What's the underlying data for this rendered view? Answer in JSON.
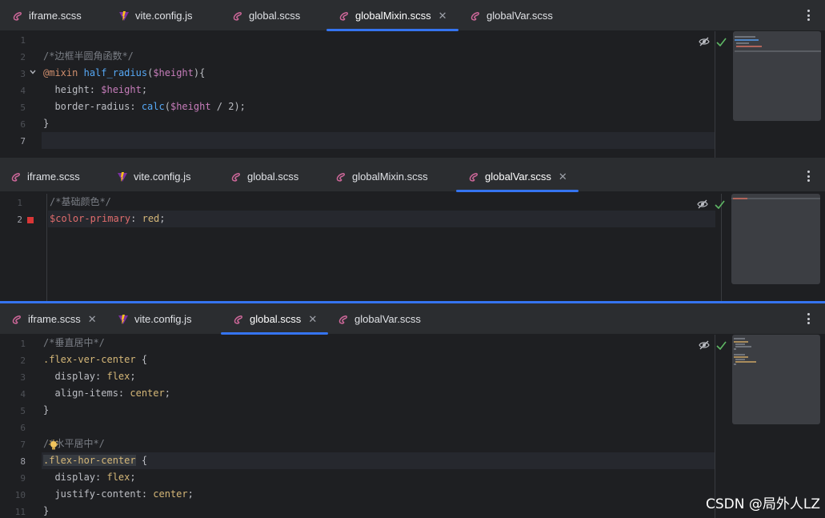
{
  "panes": [
    {
      "tabs": [
        {
          "label": "iframe.scss",
          "icon": "sass-icon"
        },
        {
          "label": "vite.config.js",
          "icon": "vite-icon"
        },
        {
          "label": "global.scss",
          "icon": "sass-icon"
        },
        {
          "label": "globalMixin.scss",
          "icon": "sass-icon",
          "active": true,
          "closable": true
        },
        {
          "label": "globalVar.scss",
          "icon": "sass-icon"
        }
      ],
      "line_numbers": [
        "1",
        "2",
        "3",
        "4",
        "5",
        "6",
        "7"
      ]
    },
    {
      "tabs": [
        {
          "label": "iframe.scss",
          "icon": "sass-icon"
        },
        {
          "label": "vite.config.js",
          "icon": "vite-icon"
        },
        {
          "label": "global.scss",
          "icon": "sass-icon"
        },
        {
          "label": "globalMixin.scss",
          "icon": "sass-icon"
        },
        {
          "label": "globalVar.scss",
          "icon": "sass-icon",
          "active": true,
          "closable": true
        }
      ],
      "line_numbers": [
        "1",
        "2"
      ]
    },
    {
      "tabs": [
        {
          "label": "iframe.scss",
          "icon": "sass-icon",
          "closable": true
        },
        {
          "label": "vite.config.js",
          "icon": "vite-icon"
        },
        {
          "label": "global.scss",
          "icon": "sass-icon",
          "active": true,
          "closable": true
        },
        {
          "label": "globalVar.scss",
          "icon": "sass-icon"
        }
      ],
      "line_numbers": [
        "1",
        "2",
        "3",
        "4",
        "5",
        "6",
        "7",
        "8",
        "9",
        "10",
        "11"
      ]
    }
  ],
  "code": {
    "p1": {
      "c2": "/*边框半圆角函数*/",
      "l3_kw": "@mixin",
      "l3_fn": "half_radius",
      "l3_p1": "(",
      "l3_var": "$height",
      "l3_p2": "){",
      "l4_prop": "  height: ",
      "l4_var": "$height",
      "l4_end": ";",
      "l5_prop": "  border-radius: ",
      "l5_fn": "calc",
      "l5_p1": "(",
      "l5_var": "$height",
      "l5_rest": " / 2);",
      "l6": "}"
    },
    "p2": {
      "c1": "/*基础颜色*/",
      "l2_var": "$color-primary",
      "l2_colon": ": ",
      "l2_val": "red",
      "l2_end": ";"
    },
    "p3": {
      "c1": "/*垂直居中*/",
      "l2_sel": ".flex-ver-center",
      "l2_brace": " {",
      "l3_prop": "  display: ",
      "l3_val": "flex",
      "l3_end": ";",
      "l4_prop": "  align-items: ",
      "l4_val": "center",
      "l4_end": ";",
      "l5": "}",
      "c7": "/*水平居中*/",
      "l8_sel": ".flex-hor-center",
      "l8_brace": " {",
      "l9_prop": "  display: ",
      "l9_val": "flex",
      "l9_end": ";",
      "l10_prop": "  justify-content: ",
      "l10_val": "center",
      "l10_end": ";",
      "l11": "}"
    }
  },
  "watermark": "CSDN @局外人LZ",
  "colors": {
    "accent": "#3574f0",
    "comment": "#7a7e85",
    "keyword": "#cf8e6d",
    "function": "#56a8f5",
    "variable": "#c77dbb",
    "value": "#d5b778"
  }
}
